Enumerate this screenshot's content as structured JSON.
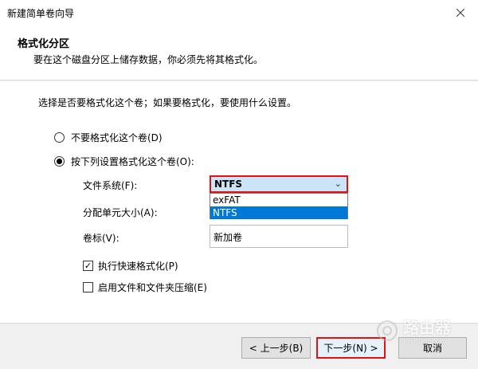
{
  "window": {
    "title": "新建简单卷向导"
  },
  "header": {
    "title": "格式化分区",
    "subtitle": "要在这个磁盘分区上储存数据，你必须先将其格式化。"
  },
  "main": {
    "prompt": "选择是否要格式化这个卷；如果要格式化，要使用什么设置。",
    "radio_no_format": {
      "label": "不要格式化这个卷(D)",
      "checked": false
    },
    "radio_format": {
      "label": "按下列设置格式化这个卷(O):",
      "checked": true
    },
    "filesystem": {
      "label": "文件系统(F):",
      "selected": "NTFS",
      "options": [
        "exFAT",
        "NTFS"
      ]
    },
    "allocation": {
      "label": "分配单元大小(A):"
    },
    "volume_label": {
      "label": "卷标(V):",
      "value": "新加卷"
    },
    "quick_format": {
      "label": "执行快速格式化(P)",
      "checked": true
    },
    "compression": {
      "label": "启用文件和文件夹压缩(E)",
      "checked": false
    }
  },
  "footer": {
    "back_label": "< 上一步(B)",
    "next_label": "下一步(N) >",
    "cancel_label": "取消"
  },
  "watermark": {
    "big": "路由器",
    "small": "luyouqi.com"
  },
  "colors": {
    "highlight_red": "#e41111",
    "selection_blue": "#0078d7"
  }
}
